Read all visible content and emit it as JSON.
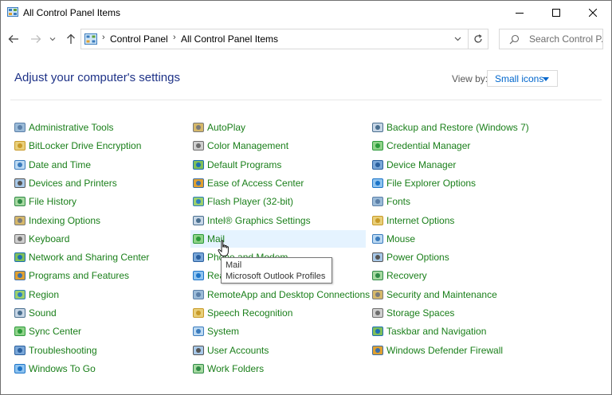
{
  "window": {
    "title": "All Control Panel Items"
  },
  "address": {
    "crumbs": [
      "Control Panel",
      "All Control Panel Items"
    ]
  },
  "search": {
    "placeholder": "Search Control P..."
  },
  "header": {
    "heading": "Adjust your computer's settings",
    "view_by_label": "View by:",
    "view_by_value": "Small icons"
  },
  "columns": [
    [
      {
        "label": "Administrative Tools",
        "icon": "admin-tools-icon"
      },
      {
        "label": "BitLocker Drive Encryption",
        "icon": "bitlocker-icon"
      },
      {
        "label": "Date and Time",
        "icon": "clock-icon"
      },
      {
        "label": "Devices and Printers",
        "icon": "printer-icon"
      },
      {
        "label": "File History",
        "icon": "file-history-icon"
      },
      {
        "label": "Indexing Options",
        "icon": "indexing-icon"
      },
      {
        "label": "Keyboard",
        "icon": "keyboard-icon"
      },
      {
        "label": "Network and Sharing Center",
        "icon": "network-icon"
      },
      {
        "label": "Programs and Features",
        "icon": "programs-icon"
      },
      {
        "label": "Region",
        "icon": "globe-clock-icon"
      },
      {
        "label": "Sound",
        "icon": "speaker-icon"
      },
      {
        "label": "Sync Center",
        "icon": "sync-icon"
      },
      {
        "label": "Troubleshooting",
        "icon": "troubleshoot-icon"
      },
      {
        "label": "Windows To Go",
        "icon": "windows-to-go-icon"
      }
    ],
    [
      {
        "label": "AutoPlay",
        "icon": "autoplay-icon"
      },
      {
        "label": "Color Management",
        "icon": "color-monitor-icon"
      },
      {
        "label": "Default Programs",
        "icon": "default-programs-icon"
      },
      {
        "label": "Ease of Access Center",
        "icon": "ease-of-access-icon"
      },
      {
        "label": "Flash Player (32-bit)",
        "icon": "flash-icon"
      },
      {
        "label": "Intel® Graphics Settings",
        "icon": "intel-graphics-icon"
      },
      {
        "label": "Mail",
        "icon": "mail-icon"
      },
      {
        "label": "Phone and Modem",
        "icon": "phone-icon"
      },
      {
        "label": "RealTek HD Audio Manager",
        "icon": "realtek-icon"
      },
      {
        "label": "RemoteApp and Desktop Connections",
        "icon": "remoteapp-icon"
      },
      {
        "label": "Speech Recognition",
        "icon": "microphone-icon"
      },
      {
        "label": "System",
        "icon": "system-monitor-icon"
      },
      {
        "label": "User Accounts",
        "icon": "users-icon"
      },
      {
        "label": "Work Folders",
        "icon": "folder-icon"
      }
    ],
    [
      {
        "label": "Backup and Restore (Windows 7)",
        "icon": "backup-icon"
      },
      {
        "label": "Credential Manager",
        "icon": "credential-icon"
      },
      {
        "label": "Device Manager",
        "icon": "device-manager-icon"
      },
      {
        "label": "File Explorer Options",
        "icon": "folder-options-icon"
      },
      {
        "label": "Fonts",
        "icon": "fonts-icon"
      },
      {
        "label": "Internet Options",
        "icon": "internet-icon"
      },
      {
        "label": "Mouse",
        "icon": "mouse-icon"
      },
      {
        "label": "Power Options",
        "icon": "power-icon"
      },
      {
        "label": "Recovery",
        "icon": "recovery-icon"
      },
      {
        "label": "Security and Maintenance",
        "icon": "flag-icon"
      },
      {
        "label": "Storage Spaces",
        "icon": "storage-icon"
      },
      {
        "label": "Taskbar and Navigation",
        "icon": "taskbar-icon"
      },
      {
        "label": "Windows Defender Firewall",
        "icon": "firewall-icon"
      }
    ]
  ],
  "hovered_item": "Mail",
  "tooltip": {
    "title": "Mail",
    "description": "Microsoft Outlook Profiles"
  },
  "colors": {
    "link_green": "#1a7f1a",
    "heading_blue": "#1e3287",
    "accent_blue": "#0066cc",
    "hover_bg": "#e5f3ff"
  }
}
